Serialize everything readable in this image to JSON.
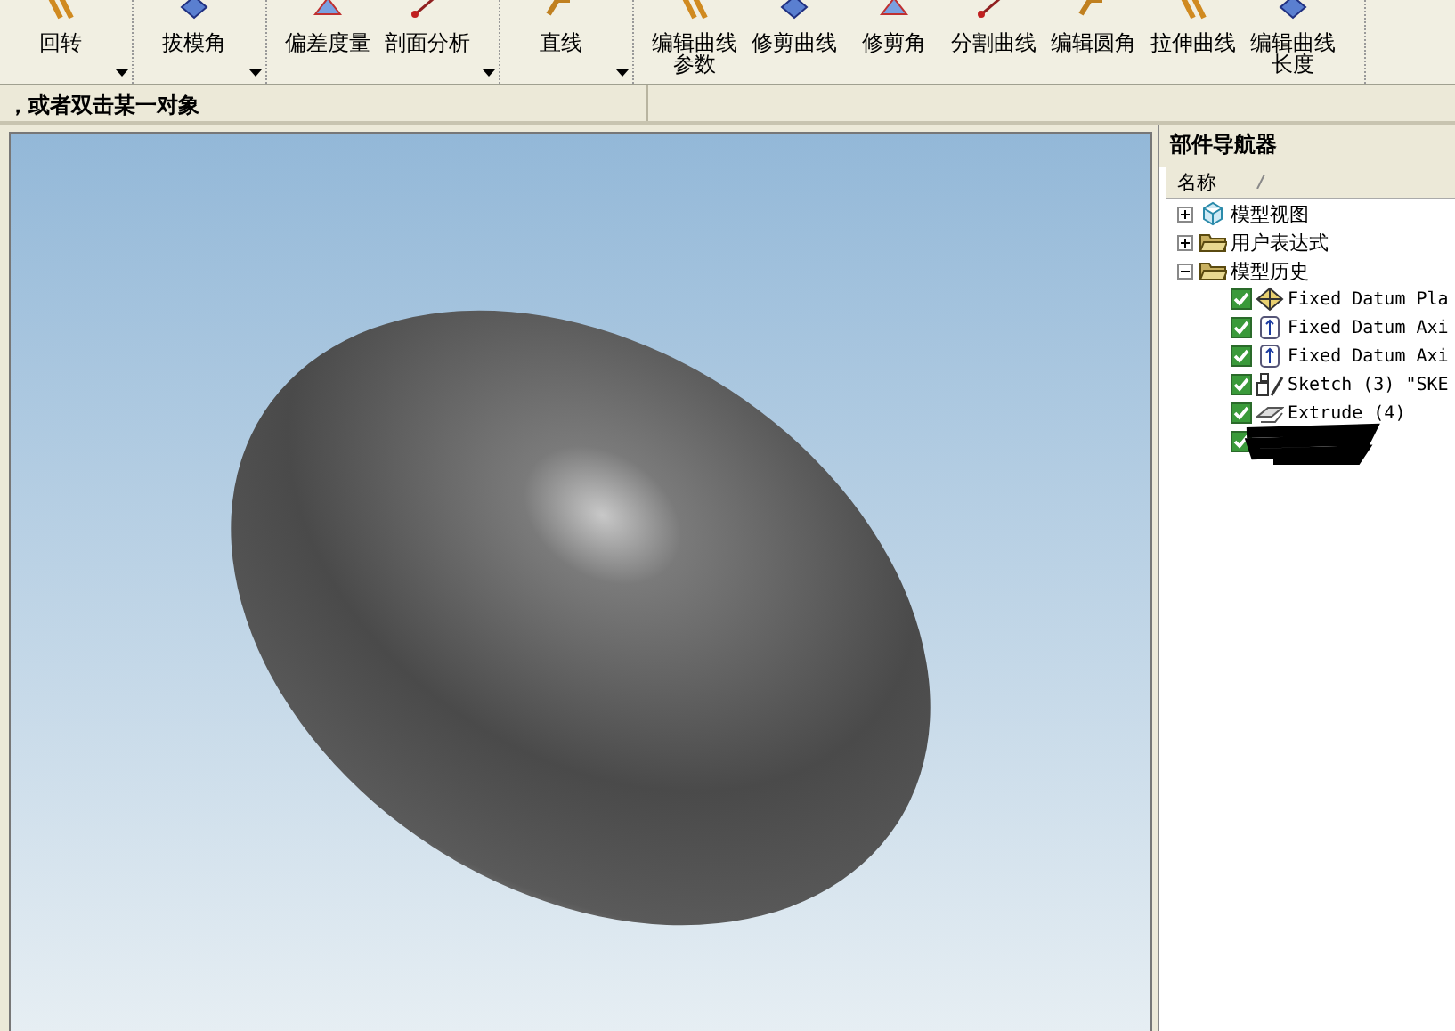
{
  "toolbar": {
    "groups": [
      {
        "buttons": [
          {
            "lines": [
              "回转"
            ]
          }
        ],
        "dropdown": true
      },
      {
        "buttons": [
          {
            "lines": [
              "拔模角"
            ]
          }
        ],
        "dropdown": true
      },
      {
        "buttons": [
          {
            "lines": [
              "偏差度量"
            ]
          },
          {
            "lines": [
              "剖面分析"
            ]
          }
        ],
        "dropdown": true
      },
      {
        "buttons": [
          {
            "lines": [
              "直线"
            ]
          }
        ],
        "dropdown": true
      },
      {
        "buttons": [
          {
            "lines": [
              "编辑曲线",
              "参数"
            ]
          },
          {
            "lines": [
              "修剪曲线"
            ]
          },
          {
            "lines": [
              "修剪角"
            ]
          },
          {
            "lines": [
              "分割曲线"
            ]
          },
          {
            "lines": [
              "编辑圆角"
            ]
          },
          {
            "lines": [
              "拉伸曲线"
            ]
          },
          {
            "lines": [
              "编辑曲线",
              "长度"
            ]
          }
        ],
        "dropdown": false
      }
    ]
  },
  "status_bar": {
    "prompt": "，或者双击某一对象"
  },
  "navigator": {
    "title": "部件导航器",
    "column": "名称",
    "tree": [
      {
        "label": "模型视图",
        "kind": "view",
        "expanded": false
      },
      {
        "label": "用户表达式",
        "kind": "folder",
        "expanded": false
      },
      {
        "label": "模型历史",
        "kind": "folder",
        "expanded": true,
        "children": [
          {
            "label": "Fixed Datum Pla",
            "kind": "plane",
            "checked": true
          },
          {
            "label": "Fixed Datum Axi",
            "kind": "axis",
            "checked": true
          },
          {
            "label": "Fixed Datum Axi",
            "kind": "axis",
            "checked": true
          },
          {
            "label": "Sketch (3) \"SKE",
            "kind": "sketch",
            "checked": true
          },
          {
            "label": "Extrude (4)",
            "kind": "extrude",
            "checked": true
          },
          {
            "kind": "redacted",
            "checked": true
          }
        ]
      }
    ]
  }
}
